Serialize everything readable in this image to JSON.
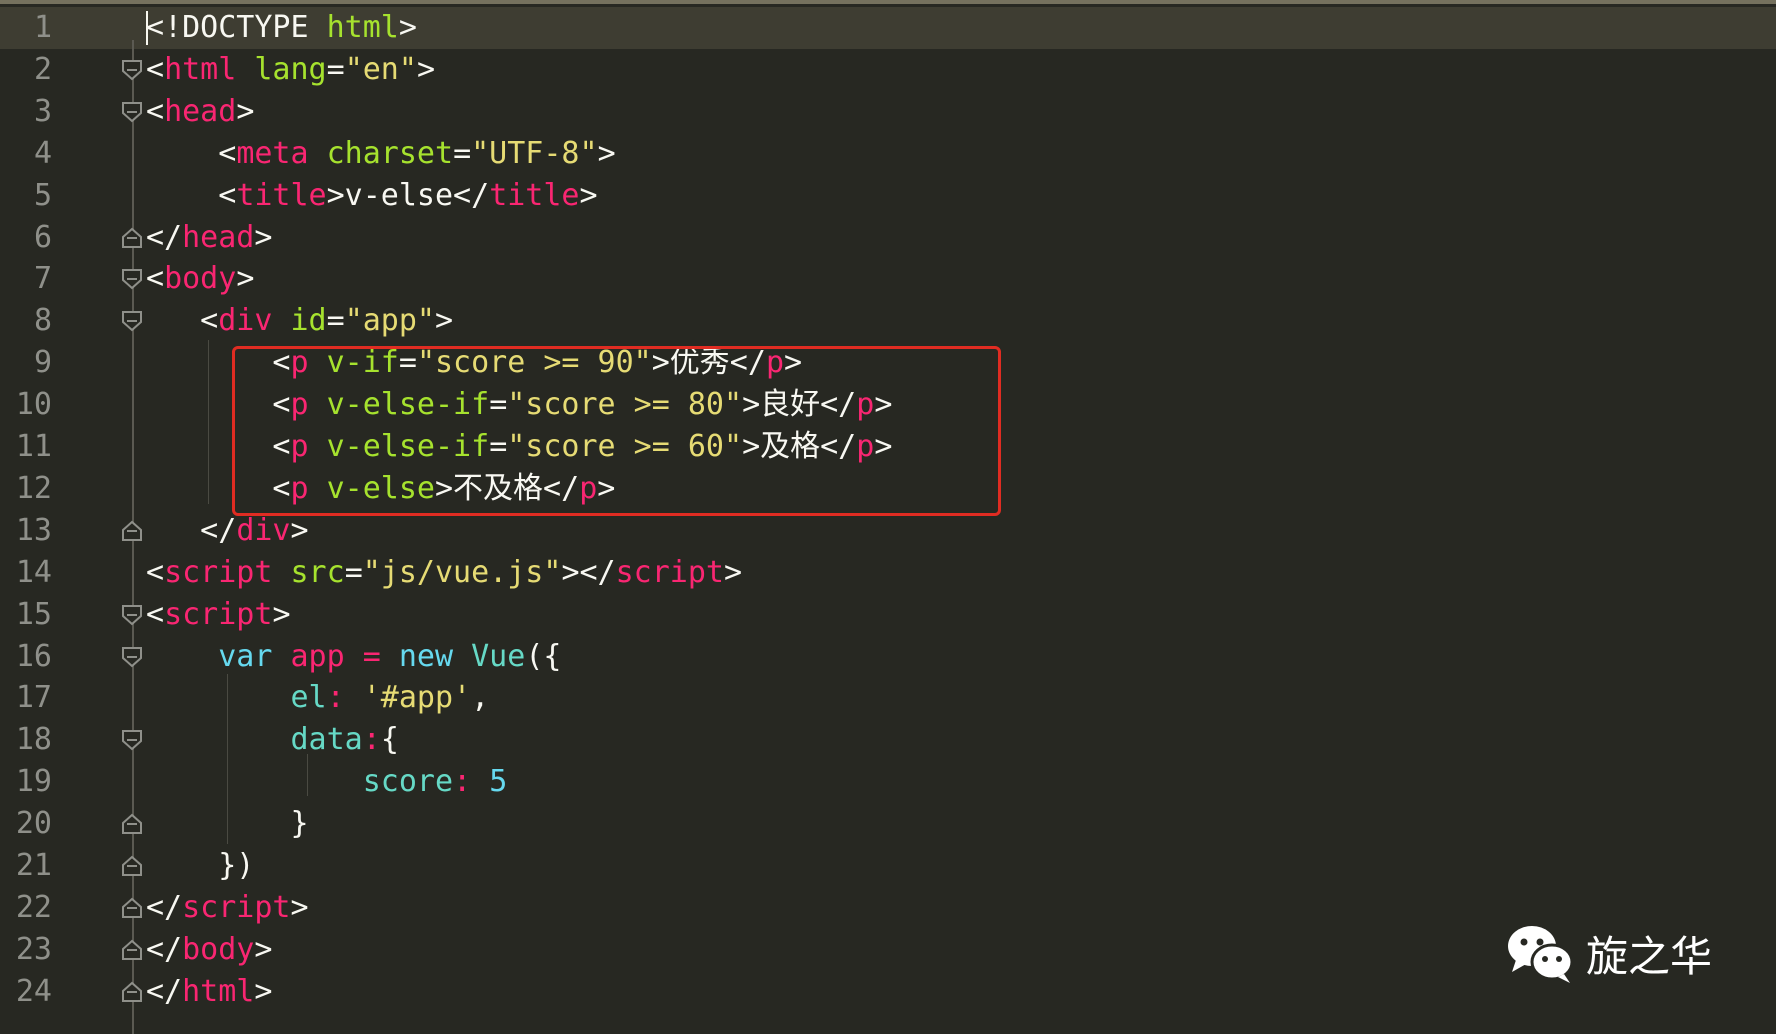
{
  "lines": [
    {
      "n": "1",
      "tokens": [
        {
          "t": "<!DOCTYPE ",
          "c": "plain"
        },
        {
          "t": "html",
          "c": "attr"
        },
        {
          "t": ">",
          "c": "plain"
        }
      ]
    },
    {
      "n": "2",
      "tokens": [
        {
          "t": "<",
          "c": "plain"
        },
        {
          "t": "html",
          "c": "tag"
        },
        {
          "t": " ",
          "c": "plain"
        },
        {
          "t": "lang",
          "c": "attr"
        },
        {
          "t": "=",
          "c": "plain"
        },
        {
          "t": "\"en\"",
          "c": "str"
        },
        {
          "t": ">",
          "c": "plain"
        }
      ]
    },
    {
      "n": "3",
      "tokens": [
        {
          "t": "<",
          "c": "plain"
        },
        {
          "t": "head",
          "c": "tag"
        },
        {
          "t": ">",
          "c": "plain"
        }
      ]
    },
    {
      "n": "4",
      "tokens": [
        {
          "t": "    <",
          "c": "plain"
        },
        {
          "t": "meta",
          "c": "tag"
        },
        {
          "t": " ",
          "c": "plain"
        },
        {
          "t": "charset",
          "c": "attr"
        },
        {
          "t": "=",
          "c": "plain"
        },
        {
          "t": "\"UTF-8\"",
          "c": "str"
        },
        {
          "t": ">",
          "c": "plain"
        }
      ]
    },
    {
      "n": "5",
      "tokens": [
        {
          "t": "    <",
          "c": "plain"
        },
        {
          "t": "title",
          "c": "tag"
        },
        {
          "t": ">v-else</",
          "c": "plain"
        },
        {
          "t": "title",
          "c": "tag"
        },
        {
          "t": ">",
          "c": "plain"
        }
      ]
    },
    {
      "n": "6",
      "tokens": [
        {
          "t": "</",
          "c": "plain"
        },
        {
          "t": "head",
          "c": "tag"
        },
        {
          "t": ">",
          "c": "plain"
        }
      ]
    },
    {
      "n": "7",
      "tokens": [
        {
          "t": "<",
          "c": "plain"
        },
        {
          "t": "body",
          "c": "tag"
        },
        {
          "t": ">",
          "c": "plain"
        }
      ]
    },
    {
      "n": "8",
      "tokens": [
        {
          "t": "   <",
          "c": "plain"
        },
        {
          "t": "div",
          "c": "tag"
        },
        {
          "t": " ",
          "c": "plain"
        },
        {
          "t": "id",
          "c": "attr"
        },
        {
          "t": "=",
          "c": "plain"
        },
        {
          "t": "\"app\"",
          "c": "str"
        },
        {
          "t": ">",
          "c": "plain"
        }
      ]
    },
    {
      "n": "9",
      "tokens": [
        {
          "t": "       <",
          "c": "plain"
        },
        {
          "t": "p",
          "c": "tag"
        },
        {
          "t": " ",
          "c": "plain"
        },
        {
          "t": "v-if",
          "c": "attr"
        },
        {
          "t": "=",
          "c": "plain"
        },
        {
          "t": "\"score >= 90\"",
          "c": "str"
        },
        {
          "t": ">优秀</",
          "c": "plain"
        },
        {
          "t": "p",
          "c": "tag"
        },
        {
          "t": ">",
          "c": "plain"
        }
      ]
    },
    {
      "n": "10",
      "tokens": [
        {
          "t": "       <",
          "c": "plain"
        },
        {
          "t": "p",
          "c": "tag"
        },
        {
          "t": " ",
          "c": "plain"
        },
        {
          "t": "v-else-if",
          "c": "attr"
        },
        {
          "t": "=",
          "c": "plain"
        },
        {
          "t": "\"score >= 80\"",
          "c": "str"
        },
        {
          "t": ">良好</",
          "c": "plain"
        },
        {
          "t": "p",
          "c": "tag"
        },
        {
          "t": ">",
          "c": "plain"
        }
      ]
    },
    {
      "n": "11",
      "tokens": [
        {
          "t": "       <",
          "c": "plain"
        },
        {
          "t": "p",
          "c": "tag"
        },
        {
          "t": " ",
          "c": "plain"
        },
        {
          "t": "v-else-if",
          "c": "attr"
        },
        {
          "t": "=",
          "c": "plain"
        },
        {
          "t": "\"score >= 60\"",
          "c": "str"
        },
        {
          "t": ">及格</",
          "c": "plain"
        },
        {
          "t": "p",
          "c": "tag"
        },
        {
          "t": ">",
          "c": "plain"
        }
      ]
    },
    {
      "n": "12",
      "tokens": [
        {
          "t": "       <",
          "c": "plain"
        },
        {
          "t": "p",
          "c": "tag"
        },
        {
          "t": " ",
          "c": "plain"
        },
        {
          "t": "v-else",
          "c": "attr"
        },
        {
          "t": ">不及格</",
          "c": "plain"
        },
        {
          "t": "p",
          "c": "tag"
        },
        {
          "t": ">",
          "c": "plain"
        }
      ]
    },
    {
      "n": "13",
      "tokens": [
        {
          "t": "   </",
          "c": "plain"
        },
        {
          "t": "div",
          "c": "tag"
        },
        {
          "t": ">",
          "c": "plain"
        }
      ]
    },
    {
      "n": "14",
      "tokens": [
        {
          "t": "<",
          "c": "plain"
        },
        {
          "t": "script",
          "c": "tag"
        },
        {
          "t": " ",
          "c": "plain"
        },
        {
          "t": "src",
          "c": "attr"
        },
        {
          "t": "=",
          "c": "plain"
        },
        {
          "t": "\"js/vue.js\"",
          "c": "str"
        },
        {
          "t": "></",
          "c": "plain"
        },
        {
          "t": "script",
          "c": "tag"
        },
        {
          "t": ">",
          "c": "plain"
        }
      ]
    },
    {
      "n": "15",
      "tokens": [
        {
          "t": "<",
          "c": "plain"
        },
        {
          "t": "script",
          "c": "tag"
        },
        {
          "t": ">",
          "c": "plain"
        }
      ]
    },
    {
      "n": "16",
      "tokens": [
        {
          "t": "    ",
          "c": "plain"
        },
        {
          "t": "var",
          "c": "kw"
        },
        {
          "t": " ",
          "c": "plain"
        },
        {
          "t": "app",
          "c": "tag"
        },
        {
          "t": " ",
          "c": "plain"
        },
        {
          "t": "=",
          "c": "op"
        },
        {
          "t": " ",
          "c": "plain"
        },
        {
          "t": "new",
          "c": "kw"
        },
        {
          "t": " ",
          "c": "plain"
        },
        {
          "t": "Vue",
          "c": "cls"
        },
        {
          "t": "({",
          "c": "plain"
        }
      ]
    },
    {
      "n": "17",
      "tokens": [
        {
          "t": "        ",
          "c": "plain"
        },
        {
          "t": "el",
          "c": "prop"
        },
        {
          "t": ":",
          "c": "op"
        },
        {
          "t": " ",
          "c": "plain"
        },
        {
          "t": "'#app'",
          "c": "str"
        },
        {
          "t": ",",
          "c": "plain"
        }
      ]
    },
    {
      "n": "18",
      "tokens": [
        {
          "t": "        ",
          "c": "plain"
        },
        {
          "t": "data",
          "c": "prop"
        },
        {
          "t": ":",
          "c": "op"
        },
        {
          "t": "{",
          "c": "plain"
        }
      ]
    },
    {
      "n": "19",
      "tokens": [
        {
          "t": "            ",
          "c": "plain"
        },
        {
          "t": "score",
          "c": "prop"
        },
        {
          "t": ":",
          "c": "op"
        },
        {
          "t": " ",
          "c": "plain"
        },
        {
          "t": "5",
          "c": "num"
        }
      ]
    },
    {
      "n": "20",
      "tokens": [
        {
          "t": "        }",
          "c": "plain"
        }
      ]
    },
    {
      "n": "21",
      "tokens": [
        {
          "t": "    })",
          "c": "plain"
        }
      ]
    },
    {
      "n": "22",
      "tokens": [
        {
          "t": "</",
          "c": "plain"
        },
        {
          "t": "script",
          "c": "tag"
        },
        {
          "t": ">",
          "c": "plain"
        }
      ]
    },
    {
      "n": "23",
      "tokens": [
        {
          "t": "</",
          "c": "plain"
        },
        {
          "t": "body",
          "c": "tag"
        },
        {
          "t": ">",
          "c": "plain"
        }
      ]
    },
    {
      "n": "24",
      "tokens": [
        {
          "t": "</",
          "c": "plain"
        },
        {
          "t": "html",
          "c": "tag"
        },
        {
          "t": ">",
          "c": "plain"
        }
      ]
    }
  ],
  "folds": {
    "2": "open",
    "3": "open",
    "6": "close",
    "7": "open",
    "8": "open",
    "13": "close",
    "15": "open",
    "16": "open",
    "18": "open",
    "20": "close",
    "21": "close",
    "22": "close",
    "23": "close",
    "24": "close"
  },
  "watermark": {
    "text": "旋之华",
    "icon": "wechat-icon"
  },
  "colors": {
    "background": "#272822",
    "highlight_border": "#e02c22",
    "tag": "#f92672",
    "attr": "#a6e22e",
    "string": "#e6db74",
    "keyword": "#66d9ef"
  }
}
